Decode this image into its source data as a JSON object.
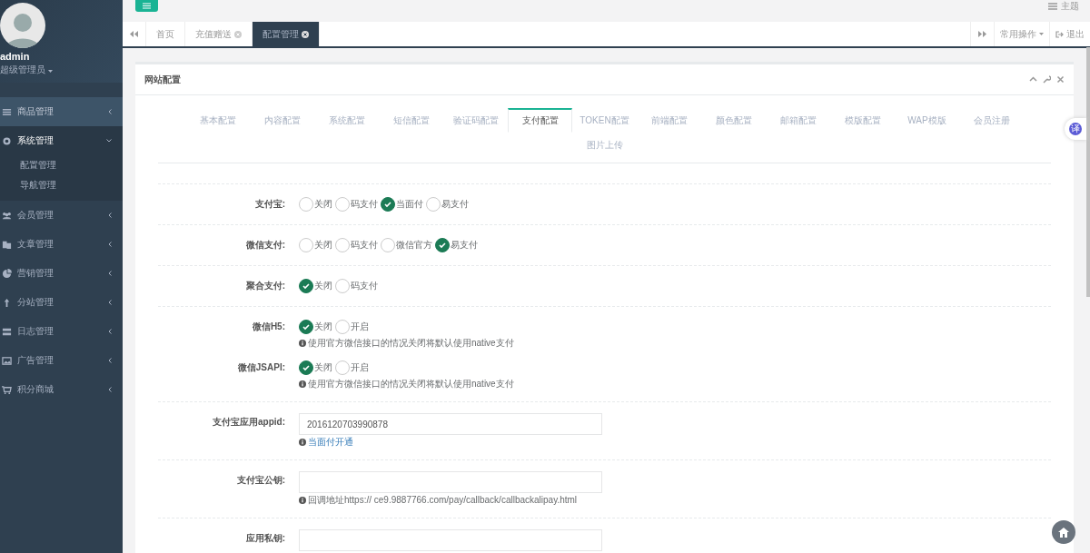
{
  "user": {
    "name": "admin",
    "role": "超级管理员"
  },
  "sidebar": {
    "items": [
      {
        "label": "商品管理",
        "highlighted": true,
        "expanded": false
      },
      {
        "label": "系统管理",
        "highlighted": false,
        "expanded": true,
        "children": [
          {
            "label": "配置管理"
          },
          {
            "label": "导航管理"
          }
        ]
      },
      {
        "label": "会员管理",
        "highlighted": false,
        "expanded": false
      },
      {
        "label": "文章管理",
        "highlighted": false,
        "expanded": false
      },
      {
        "label": "营销管理",
        "highlighted": false,
        "expanded": false
      },
      {
        "label": "分站管理",
        "highlighted": false,
        "expanded": false
      },
      {
        "label": "日志管理",
        "highlighted": false,
        "expanded": false
      },
      {
        "label": "广告管理",
        "highlighted": false,
        "expanded": false
      },
      {
        "label": "积分商城",
        "highlighted": false,
        "expanded": false
      }
    ]
  },
  "topbar": {
    "theme": "主题"
  },
  "page_tabs": [
    {
      "label": "首页",
      "closable": false,
      "selected": false
    },
    {
      "label": "充值赠送",
      "closable": true,
      "selected": false
    },
    {
      "label": "配置管理",
      "closable": true,
      "selected": true
    }
  ],
  "tab_actions": {
    "menu": "常用操作",
    "logout": "退出"
  },
  "panel": {
    "title": "网站配置",
    "tabs": [
      {
        "label": "基本配置",
        "selected": false
      },
      {
        "label": "内容配置",
        "selected": false
      },
      {
        "label": "系统配置",
        "selected": false
      },
      {
        "label": "短信配置",
        "selected": false
      },
      {
        "label": "验证码配置",
        "selected": false
      },
      {
        "label": "支付配置",
        "selected": true
      },
      {
        "label": "TOKEN配置",
        "selected": false
      },
      {
        "label": "前端配置",
        "selected": false
      },
      {
        "label": "颜色配置",
        "selected": false
      },
      {
        "label": "邮箱配置",
        "selected": false
      },
      {
        "label": "模版配置",
        "selected": false
      },
      {
        "label": "WAP模版",
        "selected": false
      },
      {
        "label": "会员注册",
        "selected": false
      },
      {
        "label": "图片上传",
        "selected": false
      }
    ],
    "sections": [
      {
        "fields": [
          {
            "kind": "radio",
            "label": "支付宝:",
            "options": [
              {
                "label": "关闭",
                "selected": false
              },
              {
                "label": "码支付",
                "selected": false
              },
              {
                "label": "当面付",
                "selected": true
              },
              {
                "label": "易支付",
                "selected": false
              }
            ]
          }
        ]
      },
      {
        "fields": [
          {
            "kind": "radio",
            "label": "微信支付:",
            "options": [
              {
                "label": "关闭",
                "selected": false
              },
              {
                "label": "码支付",
                "selected": false
              },
              {
                "label": "微信官方",
                "selected": false
              },
              {
                "label": "易支付",
                "selected": true
              }
            ]
          }
        ]
      },
      {
        "fields": [
          {
            "kind": "radio",
            "label": "聚合支付:",
            "options": [
              {
                "label": "关闭",
                "selected": true
              },
              {
                "label": "码支付",
                "selected": false
              }
            ]
          }
        ]
      },
      {
        "fields": [
          {
            "kind": "radio",
            "label": "微信H5:",
            "options": [
              {
                "label": "关闭",
                "selected": true
              },
              {
                "label": "开启",
                "selected": false
              }
            ],
            "note": {
              "kind": "plain",
              "text": "使用官方微信接口的情况关闭将默认使用native支付"
            }
          },
          {
            "kind": "radio",
            "label": "微信JSAPI:",
            "options": [
              {
                "label": "关闭",
                "selected": true
              },
              {
                "label": "开启",
                "selected": false
              }
            ],
            "note": {
              "kind": "plain",
              "text": "使用官方微信接口的情况关闭将默认使用native支付"
            }
          }
        ]
      },
      {
        "fields": [
          {
            "kind": "input",
            "label": "支付宝应用appid:",
            "value": "2016120703990878",
            "note": {
              "kind": "link",
              "text": "当面付开通"
            }
          }
        ]
      },
      {
        "fields": [
          {
            "kind": "input",
            "label": "支付宝公钥:",
            "note": {
              "kind": "plain",
              "text": "回调地址https:// ce9.9887766.com/pay/callback/callbackalipay.html"
            }
          }
        ]
      },
      {
        "fields": [
          {
            "kind": "input",
            "label": "应用私钥:"
          }
        ]
      }
    ]
  },
  "translate_button": "译"
}
